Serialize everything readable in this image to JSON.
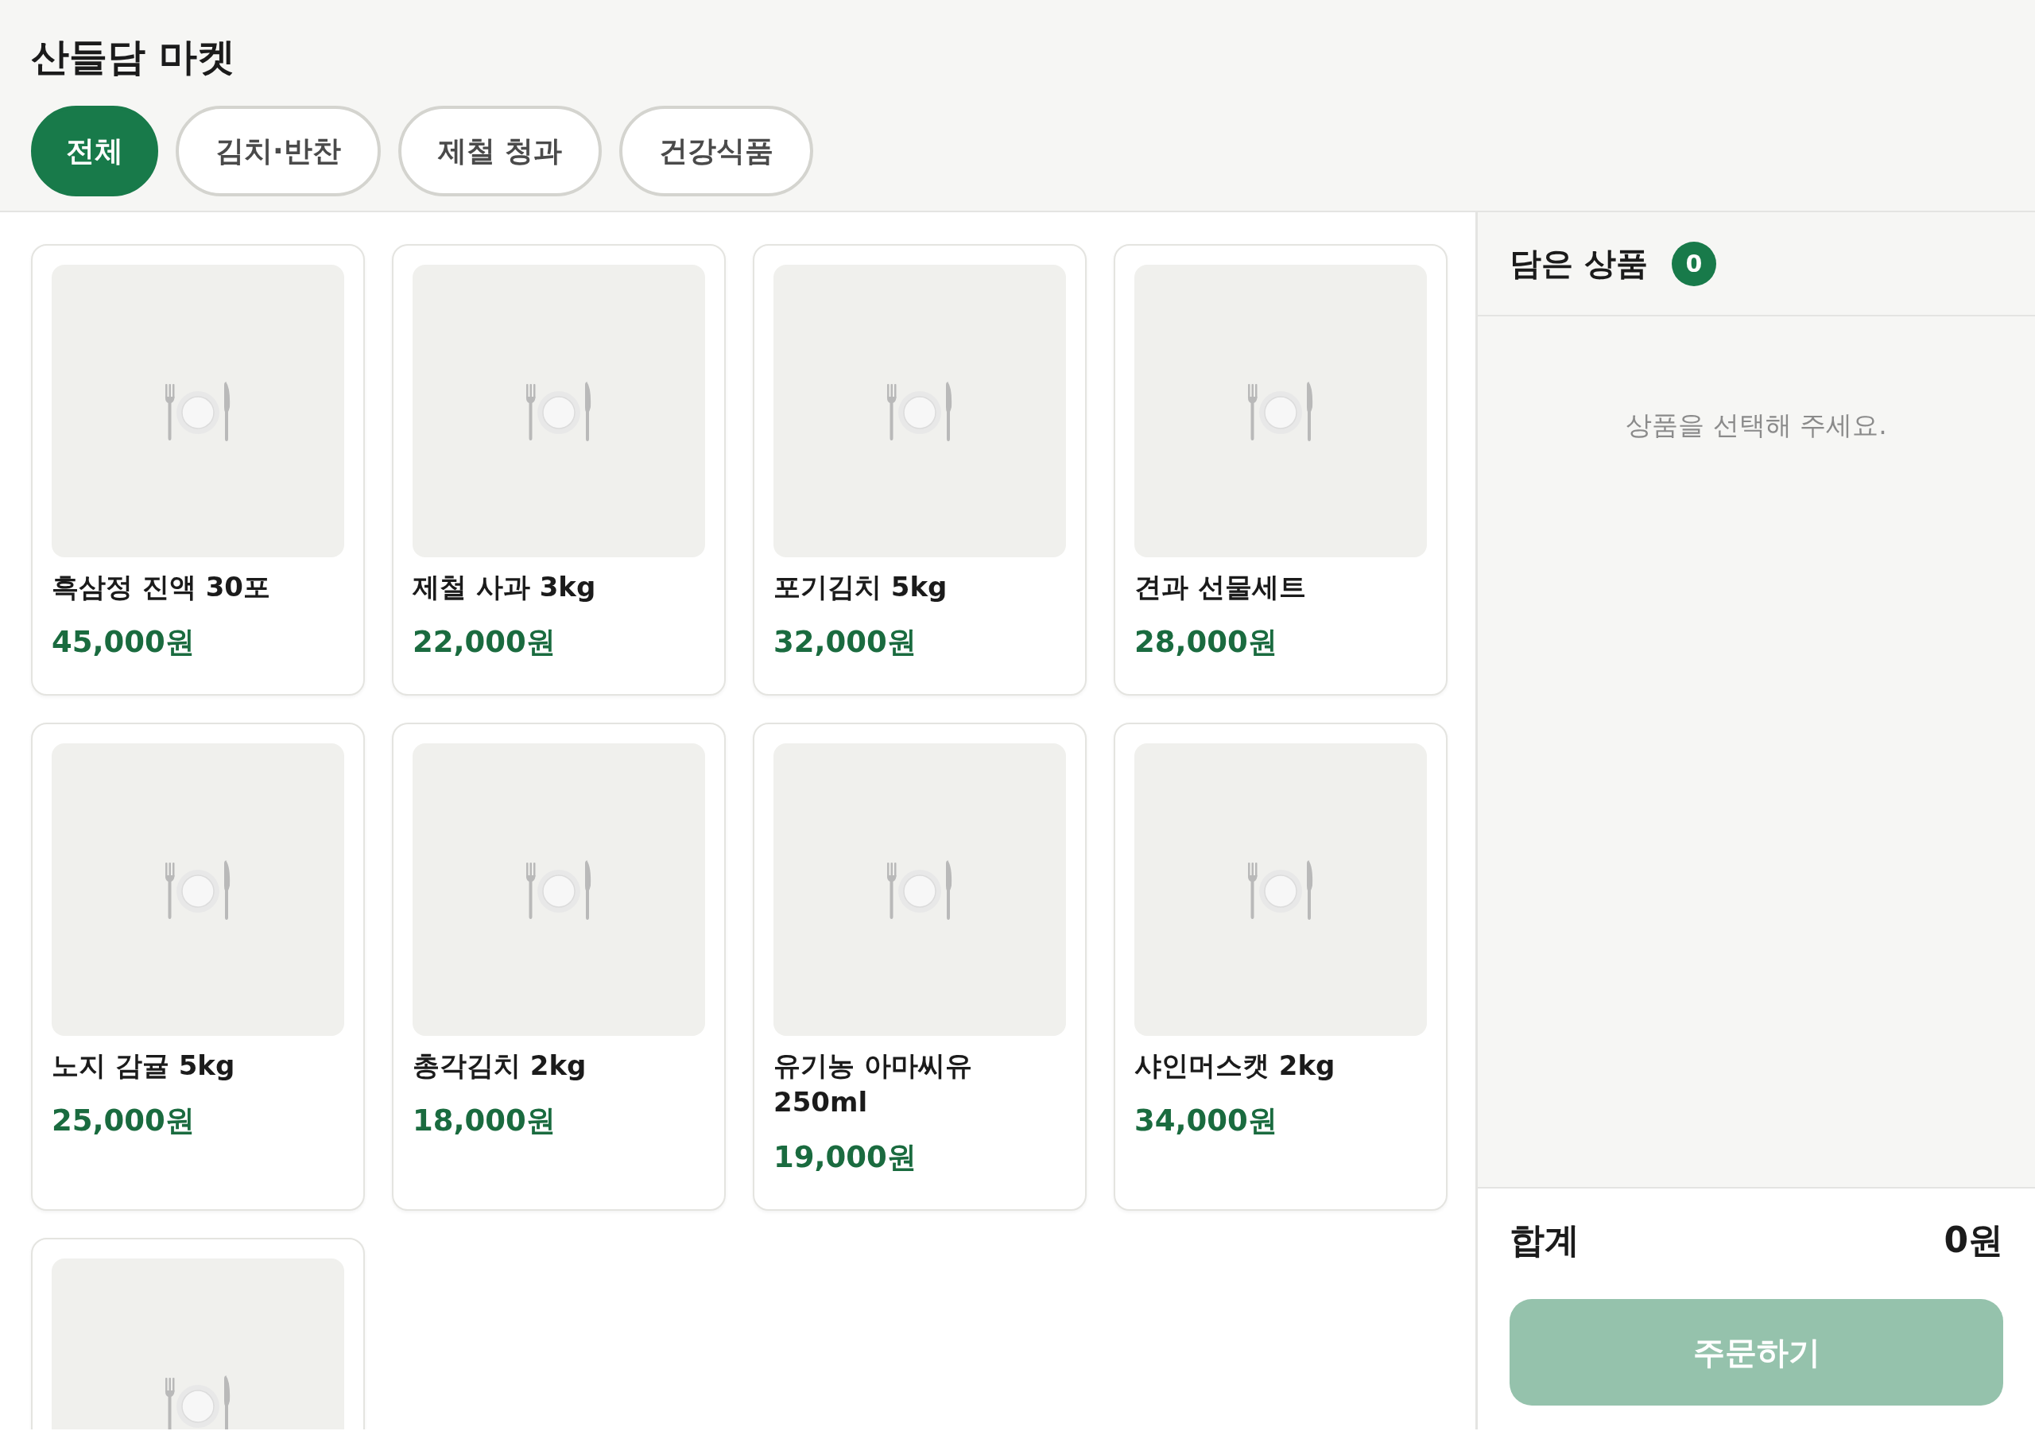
{
  "header": {
    "title": "산들담 마켓"
  },
  "tabs": [
    {
      "label": "전체",
      "selected": true
    },
    {
      "label": "김치·반찬",
      "selected": false
    },
    {
      "label": "제철 청과",
      "selected": false
    },
    {
      "label": "건강식품",
      "selected": false
    }
  ],
  "products": [
    {
      "name": "흑삼정 진액 30포",
      "price": "45,000원"
    },
    {
      "name": "제철 사과 3kg",
      "price": "22,000원"
    },
    {
      "name": "포기김치 5kg",
      "price": "32,000원"
    },
    {
      "name": "견과 선물세트",
      "price": "28,000원"
    },
    {
      "name": "노지 감귤 5kg",
      "price": "25,000원"
    },
    {
      "name": "총각김치 2kg",
      "price": "18,000원"
    },
    {
      "name": "유기농 아마씨유 250ml",
      "price": "19,000원"
    },
    {
      "name": "샤인머스캣 2kg",
      "price": "34,000원"
    },
    {
      "kind": "partial"
    }
  ],
  "cart": {
    "title": "담은 상품",
    "count": "0",
    "empty_message": "상품을 선택해 주세요.",
    "total_label": "합계",
    "total": "0원",
    "order_button": {
      "label": "주문하기",
      "disabled": true
    }
  }
}
